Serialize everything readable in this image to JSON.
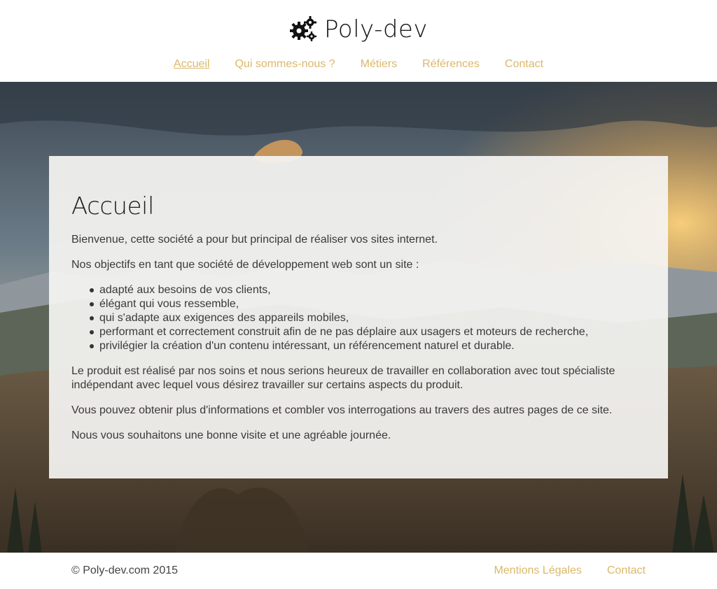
{
  "brand": {
    "name": "Poly-dev",
    "icon": "gears-icon"
  },
  "nav": {
    "items": [
      {
        "label": "Accueil",
        "active": true
      },
      {
        "label": "Qui sommes-nous ?",
        "active": false
      },
      {
        "label": "Métiers",
        "active": false
      },
      {
        "label": "Références",
        "active": false
      },
      {
        "label": "Contact",
        "active": false
      }
    ]
  },
  "main": {
    "title": "Accueil",
    "intro": "Bienvenue, cette société a pour but principal de réaliser vos sites internet.",
    "objectives_intro": "Nos objectifs en tant que société de développement web sont un site :",
    "objectives": [
      "adapté aux besoins de vos clients,",
      "élégant qui vous ressemble,",
      "qui s'adapte aux exigences des appareils mobiles,",
      "performant et correctement construit afin de ne pas déplaire aux usagers et moteurs de recherche,",
      "privilégier la création d'un contenu intéressant, un référencement naturel et durable."
    ],
    "paragraph_product": "Le produit est réalisé par nos soins et nous serions heureux de travailler en collaboration avec tout spécialiste indépendant avec lequel vous désirez travailler sur certains aspects du produit.",
    "paragraph_info": "Vous pouvez obtenir plus d'informations et combler vos interrogations au travers des autres pages de ce site.",
    "paragraph_closing": "Nous vous souhaitons une bonne visite et une agréable journée."
  },
  "footer": {
    "copyright": "© Poly-dev.com 2015",
    "links": [
      "Mentions Légales",
      "Contact"
    ]
  },
  "colors": {
    "accent": "#dbb86a",
    "text": "#3a3a3a",
    "panel": "#f5f4f2"
  }
}
